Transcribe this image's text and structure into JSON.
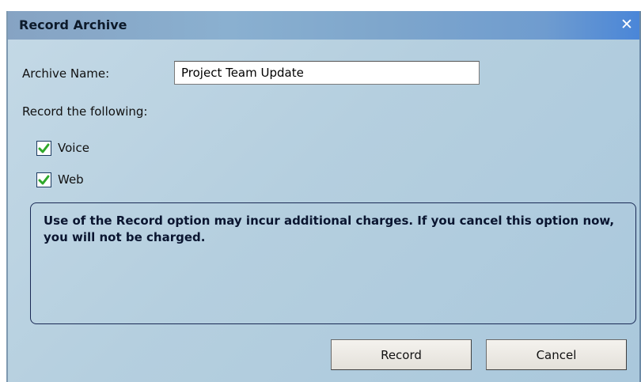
{
  "window": {
    "title": "Record Archive",
    "close_icon": "close-icon"
  },
  "archive_name": {
    "label": "Archive Name:",
    "value": "Project Team Update"
  },
  "record_section": {
    "label": "Record the following:",
    "options": [
      {
        "label": "Voice",
        "checked": true
      },
      {
        "label": "Web",
        "checked": true
      }
    ]
  },
  "notice": {
    "text": "Use of the Record option may incur additional charges.  If you cancel this option now, you will not be charged."
  },
  "buttons": {
    "record_label": "Record",
    "cancel_label": "Cancel"
  },
  "colors": {
    "check_mark": "#2fa82a",
    "title_bar": "#7ea6cc",
    "dialog_bg": "#b5cfdf"
  }
}
